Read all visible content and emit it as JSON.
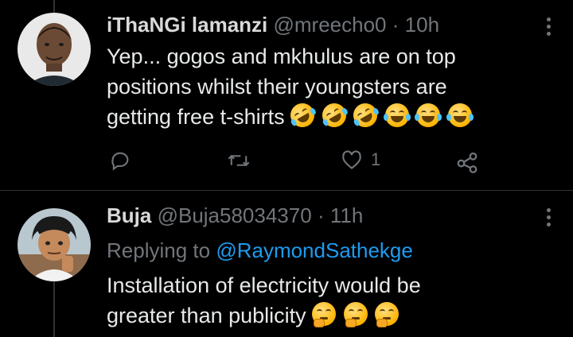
{
  "tweets": [
    {
      "name": "iThaNGi lamanzi",
      "handle": "@mreecho0",
      "sep": "·",
      "time": "10h",
      "lines": [
        "Yep... gogos and mkhulus are on top",
        "positions whilst their youngsters are",
        "getting free t-shirts"
      ],
      "emojis": [
        "rofl-emoji",
        "rofl-emoji",
        "rofl-emoji",
        "joy-emoji",
        "joy-emoji",
        "joy-emoji"
      ],
      "actions": {
        "reply_count": "",
        "retweet_count": "",
        "like_count": "1"
      }
    },
    {
      "name": "Buja",
      "handle": "@Buja58034370",
      "sep": "·",
      "time": "11h",
      "replying_prefix": "Replying to",
      "replying_to": "@RaymondSathekge",
      "lines": [
        "Installation of electricity would be",
        "greater than publicity"
      ],
      "emojis": [
        "thinking-emoji",
        "thinking-emoji",
        "thinking-emoji"
      ]
    }
  ],
  "colors": {
    "background": "#000000",
    "muted": "#71767b",
    "link": "#1d9bf0",
    "divider": "#2f3336"
  }
}
